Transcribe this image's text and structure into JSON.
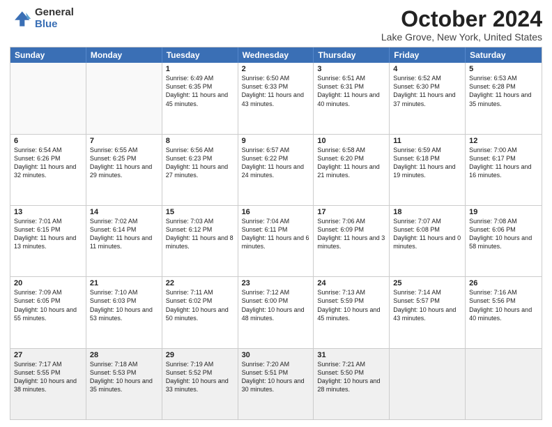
{
  "logo": {
    "general": "General",
    "blue": "Blue"
  },
  "header": {
    "month": "October 2024",
    "location": "Lake Grove, New York, United States"
  },
  "days": [
    "Sunday",
    "Monday",
    "Tuesday",
    "Wednesday",
    "Thursday",
    "Friday",
    "Saturday"
  ],
  "weeks": [
    [
      {
        "day": "",
        "info": "",
        "empty": true
      },
      {
        "day": "",
        "info": "",
        "empty": true
      },
      {
        "day": "1",
        "info": "Sunrise: 6:49 AM\nSunset: 6:35 PM\nDaylight: 11 hours and 45 minutes."
      },
      {
        "day": "2",
        "info": "Sunrise: 6:50 AM\nSunset: 6:33 PM\nDaylight: 11 hours and 43 minutes."
      },
      {
        "day": "3",
        "info": "Sunrise: 6:51 AM\nSunset: 6:31 PM\nDaylight: 11 hours and 40 minutes."
      },
      {
        "day": "4",
        "info": "Sunrise: 6:52 AM\nSunset: 6:30 PM\nDaylight: 11 hours and 37 minutes."
      },
      {
        "day": "5",
        "info": "Sunrise: 6:53 AM\nSunset: 6:28 PM\nDaylight: 11 hours and 35 minutes."
      }
    ],
    [
      {
        "day": "6",
        "info": "Sunrise: 6:54 AM\nSunset: 6:26 PM\nDaylight: 11 hours and 32 minutes."
      },
      {
        "day": "7",
        "info": "Sunrise: 6:55 AM\nSunset: 6:25 PM\nDaylight: 11 hours and 29 minutes."
      },
      {
        "day": "8",
        "info": "Sunrise: 6:56 AM\nSunset: 6:23 PM\nDaylight: 11 hours and 27 minutes."
      },
      {
        "day": "9",
        "info": "Sunrise: 6:57 AM\nSunset: 6:22 PM\nDaylight: 11 hours and 24 minutes."
      },
      {
        "day": "10",
        "info": "Sunrise: 6:58 AM\nSunset: 6:20 PM\nDaylight: 11 hours and 21 minutes."
      },
      {
        "day": "11",
        "info": "Sunrise: 6:59 AM\nSunset: 6:18 PM\nDaylight: 11 hours and 19 minutes."
      },
      {
        "day": "12",
        "info": "Sunrise: 7:00 AM\nSunset: 6:17 PM\nDaylight: 11 hours and 16 minutes."
      }
    ],
    [
      {
        "day": "13",
        "info": "Sunrise: 7:01 AM\nSunset: 6:15 PM\nDaylight: 11 hours and 13 minutes."
      },
      {
        "day": "14",
        "info": "Sunrise: 7:02 AM\nSunset: 6:14 PM\nDaylight: 11 hours and 11 minutes."
      },
      {
        "day": "15",
        "info": "Sunrise: 7:03 AM\nSunset: 6:12 PM\nDaylight: 11 hours and 8 minutes."
      },
      {
        "day": "16",
        "info": "Sunrise: 7:04 AM\nSunset: 6:11 PM\nDaylight: 11 hours and 6 minutes."
      },
      {
        "day": "17",
        "info": "Sunrise: 7:06 AM\nSunset: 6:09 PM\nDaylight: 11 hours and 3 minutes."
      },
      {
        "day": "18",
        "info": "Sunrise: 7:07 AM\nSunset: 6:08 PM\nDaylight: 11 hours and 0 minutes."
      },
      {
        "day": "19",
        "info": "Sunrise: 7:08 AM\nSunset: 6:06 PM\nDaylight: 10 hours and 58 minutes."
      }
    ],
    [
      {
        "day": "20",
        "info": "Sunrise: 7:09 AM\nSunset: 6:05 PM\nDaylight: 10 hours and 55 minutes."
      },
      {
        "day": "21",
        "info": "Sunrise: 7:10 AM\nSunset: 6:03 PM\nDaylight: 10 hours and 53 minutes."
      },
      {
        "day": "22",
        "info": "Sunrise: 7:11 AM\nSunset: 6:02 PM\nDaylight: 10 hours and 50 minutes."
      },
      {
        "day": "23",
        "info": "Sunrise: 7:12 AM\nSunset: 6:00 PM\nDaylight: 10 hours and 48 minutes."
      },
      {
        "day": "24",
        "info": "Sunrise: 7:13 AM\nSunset: 5:59 PM\nDaylight: 10 hours and 45 minutes."
      },
      {
        "day": "25",
        "info": "Sunrise: 7:14 AM\nSunset: 5:57 PM\nDaylight: 10 hours and 43 minutes."
      },
      {
        "day": "26",
        "info": "Sunrise: 7:16 AM\nSunset: 5:56 PM\nDaylight: 10 hours and 40 minutes."
      }
    ],
    [
      {
        "day": "27",
        "info": "Sunrise: 7:17 AM\nSunset: 5:55 PM\nDaylight: 10 hours and 38 minutes."
      },
      {
        "day": "28",
        "info": "Sunrise: 7:18 AM\nSunset: 5:53 PM\nDaylight: 10 hours and 35 minutes."
      },
      {
        "day": "29",
        "info": "Sunrise: 7:19 AM\nSunset: 5:52 PM\nDaylight: 10 hours and 33 minutes."
      },
      {
        "day": "30",
        "info": "Sunrise: 7:20 AM\nSunset: 5:51 PM\nDaylight: 10 hours and 30 minutes."
      },
      {
        "day": "31",
        "info": "Sunrise: 7:21 AM\nSunset: 5:50 PM\nDaylight: 10 hours and 28 minutes."
      },
      {
        "day": "",
        "info": "",
        "empty": true
      },
      {
        "day": "",
        "info": "",
        "empty": true
      }
    ]
  ]
}
